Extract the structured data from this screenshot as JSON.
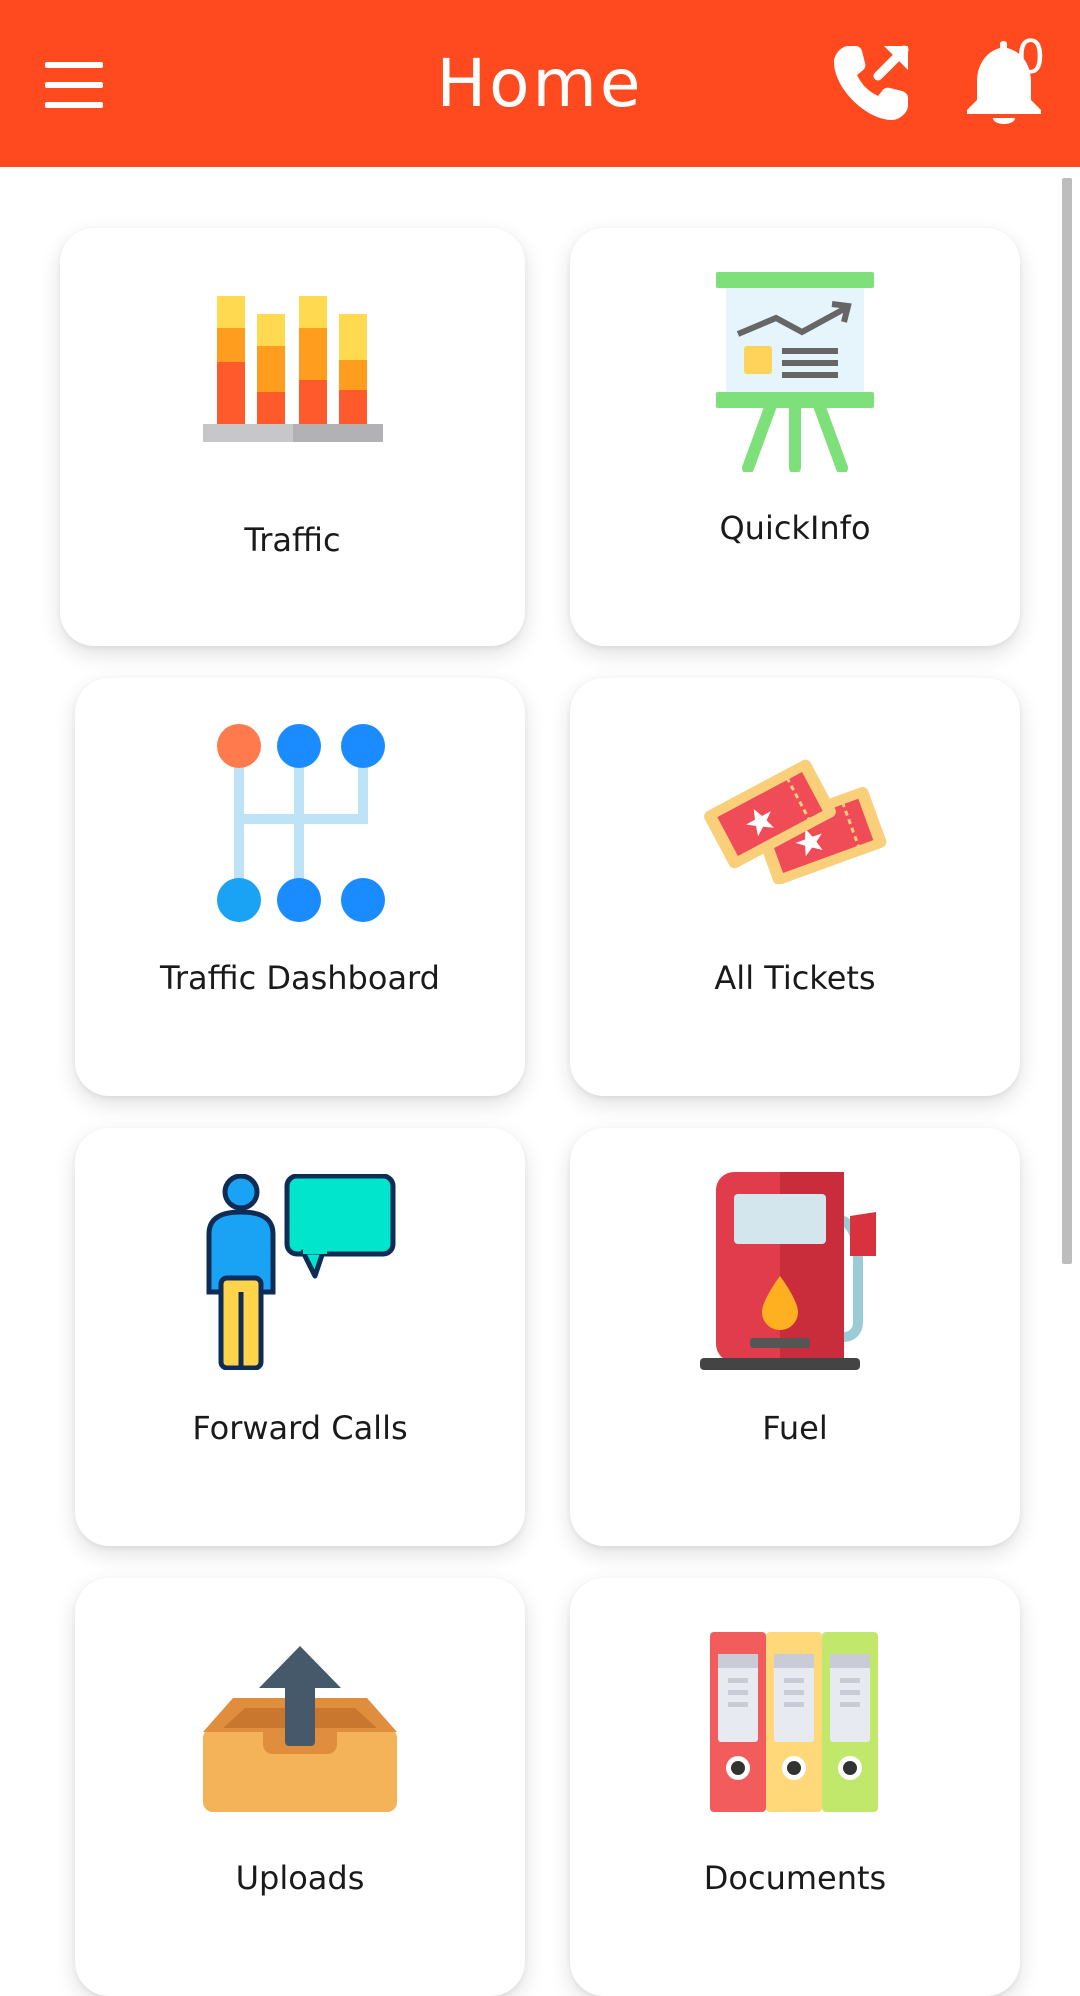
{
  "header": {
    "title": "Home",
    "notification_count": "0",
    "background_color": "#ff4a1f",
    "icons": {
      "menu": "hamburger-menu-icon",
      "call": "phone-forward-icon",
      "notifications": "bell-icon"
    }
  },
  "tiles": [
    {
      "label": "Traffic",
      "icon": "bar-chart-icon"
    },
    {
      "label": "QuickInfo",
      "icon": "presentation-board-icon"
    },
    {
      "label": "Traffic Dashboard",
      "icon": "gear-shift-icon"
    },
    {
      "label": "All Tickets",
      "icon": "tickets-icon"
    },
    {
      "label": "Forward Calls",
      "icon": "person-speech-icon"
    },
    {
      "label": "Fuel",
      "icon": "fuel-pump-icon"
    },
    {
      "label": "Uploads",
      "icon": "upload-box-icon"
    },
    {
      "label": "Documents",
      "icon": "binders-icon"
    }
  ]
}
